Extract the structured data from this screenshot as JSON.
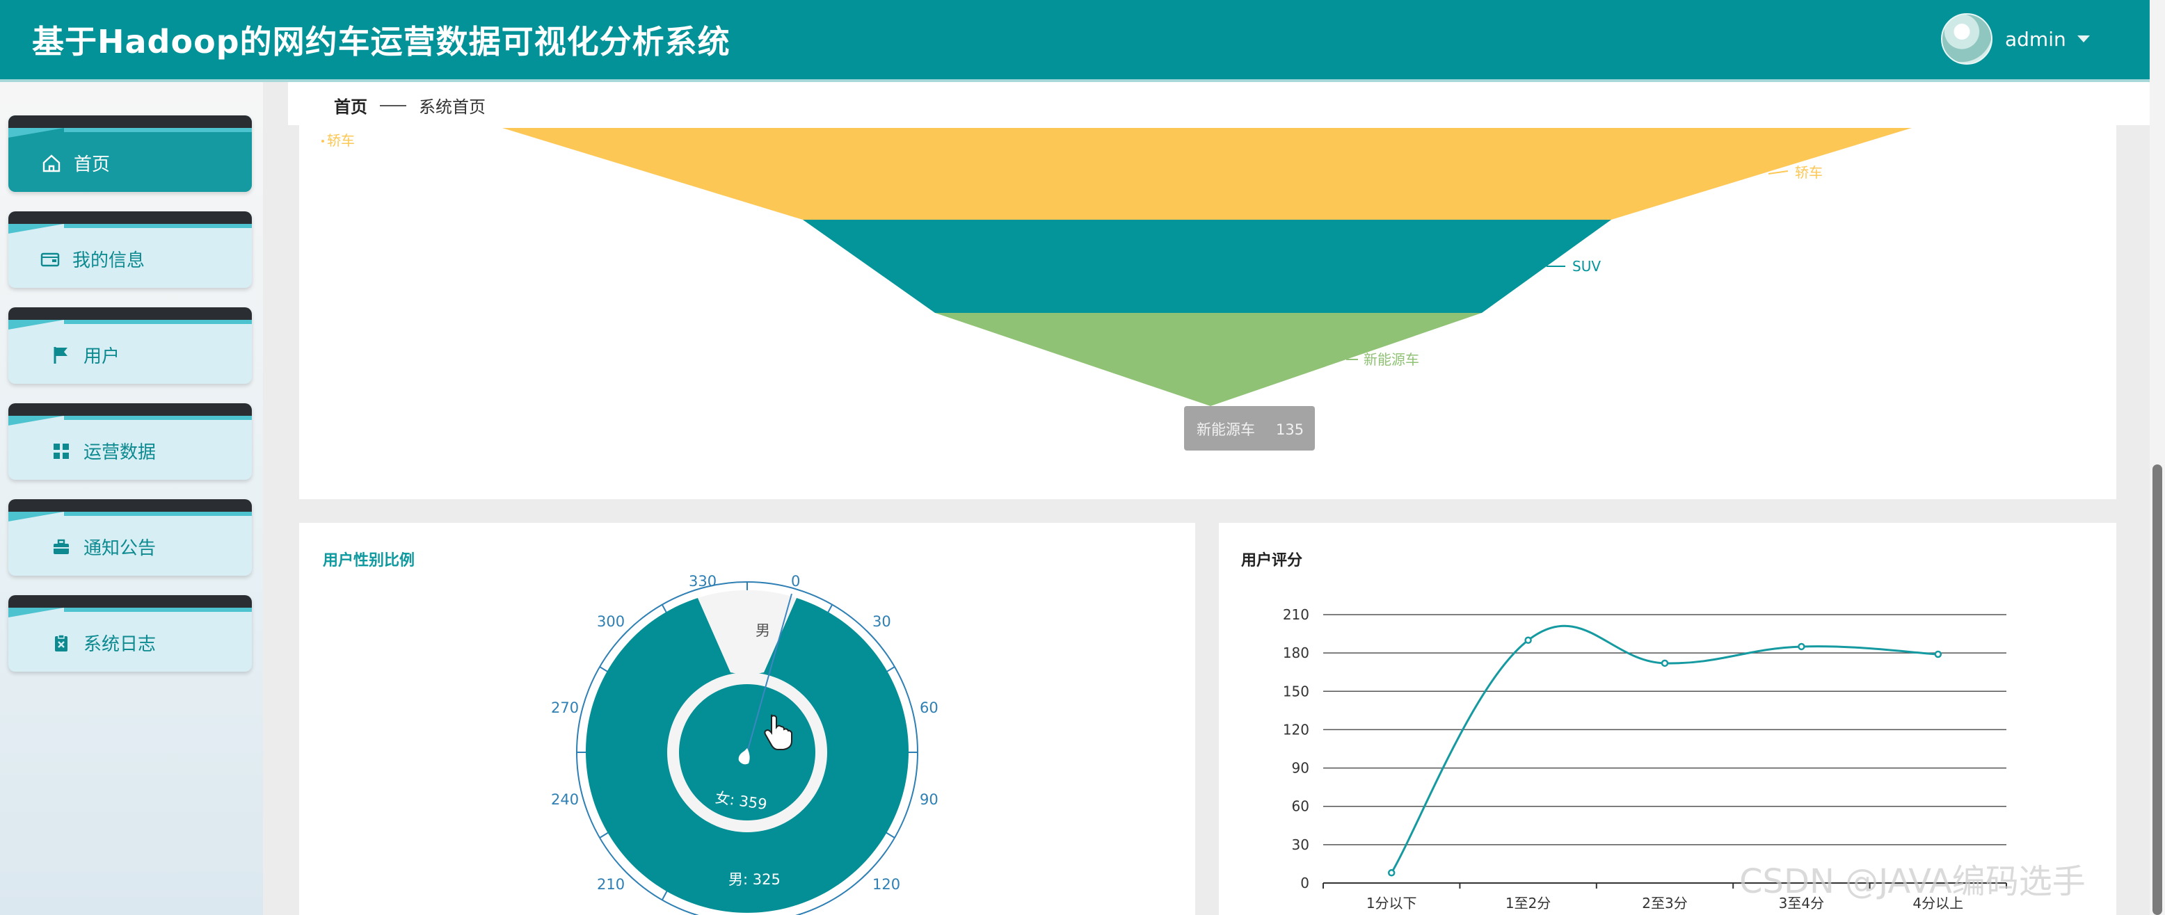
{
  "header": {
    "title": "基于Hadoop的网约车运营数据可视化分析系统",
    "username": "admin"
  },
  "sidebar": {
    "items": [
      {
        "label": "首页",
        "icon": "home-icon",
        "active": true
      },
      {
        "label": "我的信息",
        "icon": "wallet-icon",
        "active": false
      },
      {
        "label": "用户",
        "icon": "flag-icon",
        "active": false
      },
      {
        "label": "运营数据",
        "icon": "grid-icon",
        "active": false
      },
      {
        "label": "通知公告",
        "icon": "briefcase-icon",
        "active": false
      },
      {
        "label": "系统日志",
        "icon": "clipboard-icon",
        "active": false
      }
    ]
  },
  "breadcrumb": {
    "home": "首页",
    "current": "系统首页"
  },
  "funnel": {
    "labels": [
      "轿车",
      "SUV",
      "新能源车"
    ],
    "colors": [
      "#fdc755",
      "#03959a",
      "#8fc274"
    ],
    "tooltip_name": "新能源车",
    "tooltip_value": "135"
  },
  "gender_panel": {
    "title": "用户性别比例",
    "dial_ticks": [
      "0",
      "30",
      "60",
      "90",
      "120",
      "210",
      "240",
      "270",
      "300",
      "330"
    ],
    "male_label": "男",
    "female_inner_label": "女: 359",
    "male_bottom_label": "男: 325",
    "accent": "#038f95"
  },
  "rating_panel": {
    "title": "用户评分"
  },
  "chart_data": [
    {
      "type": "line",
      "title": "用户评分",
      "categories": [
        "1分以下",
        "1至2分",
        "2至3分",
        "3至4分",
        "4分以上"
      ],
      "values": [
        8,
        190,
        172,
        185,
        179
      ],
      "ylim": [
        0,
        210
      ],
      "yticks": [
        "0",
        "30",
        "60",
        "90",
        "120",
        "150",
        "180",
        "210"
      ],
      "smooth": true,
      "color": "#149aa0",
      "grid": true
    },
    {
      "type": "pie",
      "title": "用户性别比例",
      "categories": [
        "女",
        "男"
      ],
      "values": [
        359,
        325
      ]
    }
  ],
  "watermark": "CSDN @JAVA编码选手"
}
